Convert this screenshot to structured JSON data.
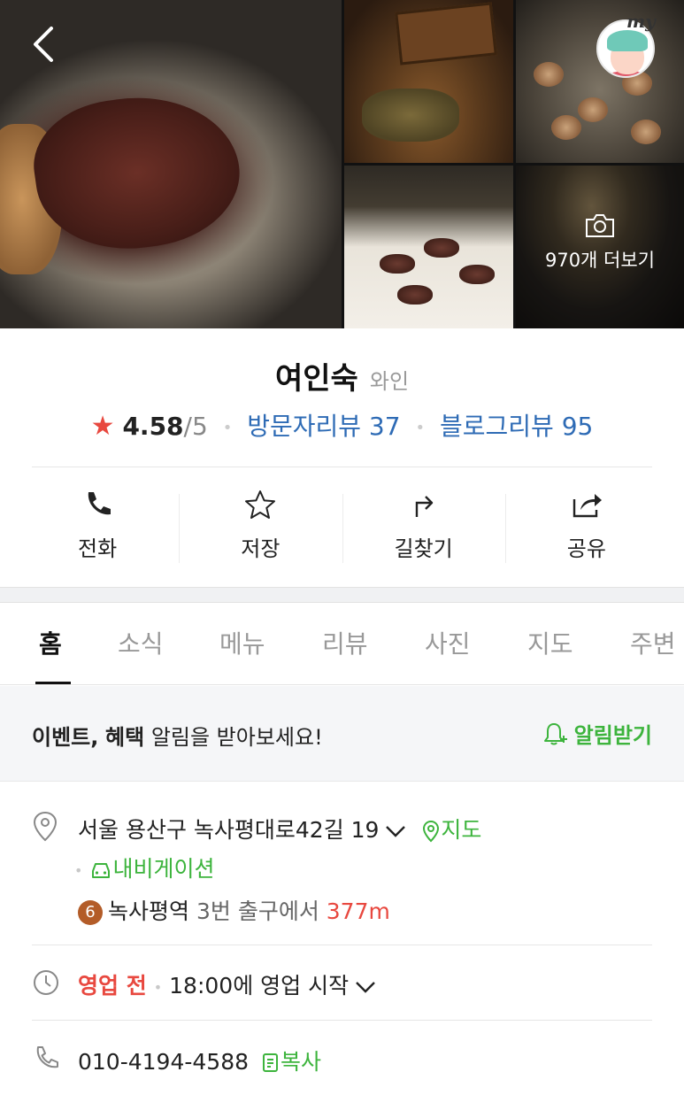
{
  "gallery": {
    "more_count_label": "970개 더보기"
  },
  "header": {
    "my_label": "my"
  },
  "place": {
    "name": "여인숙",
    "category": "와인",
    "rating": "4.58",
    "rating_max": "/5",
    "visitor_reviews": "방문자리뷰 37",
    "blog_reviews": "블로그리뷰 95"
  },
  "actions": [
    {
      "label": "전화",
      "icon": "phone-icon"
    },
    {
      "label": "저장",
      "icon": "star-outline-icon"
    },
    {
      "label": "길찾기",
      "icon": "directions-icon"
    },
    {
      "label": "공유",
      "icon": "share-icon"
    }
  ],
  "tabs": [
    "홈",
    "소식",
    "메뉴",
    "리뷰",
    "사진",
    "지도",
    "주변"
  ],
  "notice": {
    "bold1": "이벤트,",
    "bold2": "혜택",
    "rest": "알림을 받아보세요!",
    "button": "알림받기"
  },
  "info": {
    "address": "서울 용산구 녹사평대로42길 19",
    "map_link": "지도",
    "navigation_link": "내비게이션",
    "station_line": "6",
    "station_name": "녹사평역",
    "station_exit": "3번 출구에서",
    "station_distance": "377m",
    "hours_status": "영업 전",
    "hours_text": "18:00에 영업 시작",
    "phone": "010-4194-4588",
    "copy_label": "복사"
  },
  "colors": {
    "accent_green": "#3db43d",
    "link_blue": "#2e6bb5",
    "alert_red": "#e8483f",
    "star_red": "#e8483f"
  }
}
